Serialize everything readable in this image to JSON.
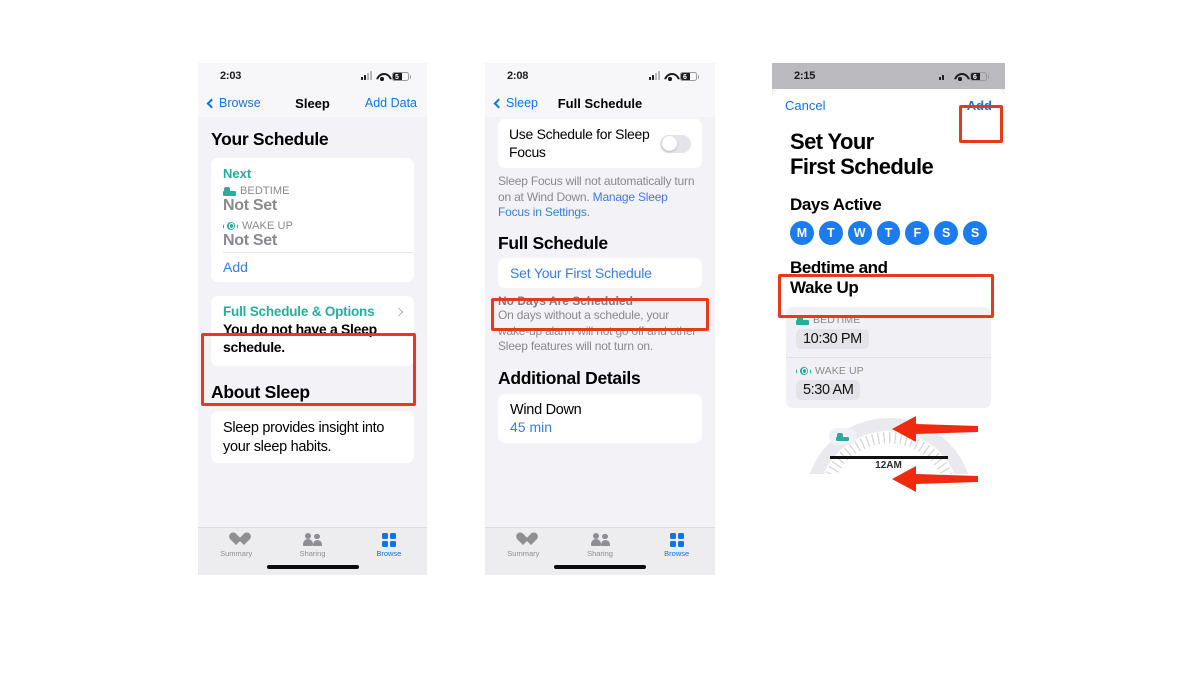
{
  "colors": {
    "annotation_red": "#e8391b",
    "ios_blue": "#1673d8",
    "link_blue": "#3b7ddd",
    "teal": "#2bab9e",
    "day_blue": "#1a7ced",
    "gray_text": "#8a8a8e"
  },
  "screen1": {
    "status": {
      "time": "2:03",
      "signal_icon": "cellular-signal-icon",
      "wifi_icon": "wifi-icon",
      "battery_icon": "battery-low-icon"
    },
    "nav": {
      "back_label": "Browse",
      "title": "Sleep",
      "right_label": "Add Data"
    },
    "section_title": "Your Schedule",
    "schedule_card": {
      "next_label": "Next",
      "bedtime_label": "BEDTIME",
      "bedtime_value": "Not Set",
      "wakeup_label": "WAKE UP",
      "wakeup_value": "Not Set",
      "add_label": "Add"
    },
    "full_schedule": {
      "link_label": "Full Schedule & Options",
      "message": "You do not have a Sleep schedule."
    },
    "about_title": "About Sleep",
    "about_body": "Sleep provides insight into your sleep habits.",
    "tabs": [
      {
        "label": "Summary",
        "icon": "heart-icon",
        "active": false
      },
      {
        "label": "Sharing",
        "icon": "people-icon",
        "active": false
      },
      {
        "label": "Browse",
        "icon": "grid-icon",
        "active": true
      }
    ]
  },
  "screen2": {
    "status": {
      "time": "2:08"
    },
    "nav": {
      "back_label": "Sleep",
      "title": "Full Schedule"
    },
    "focus_row": {
      "label": "Use Schedule for Sleep Focus",
      "toggle_state": "off"
    },
    "focus_helper_text": "Sleep Focus will not automatically turn on at Wind Down. ",
    "focus_helper_link": "Manage Sleep Focus in Settings.",
    "full_schedule_title": "Full Schedule",
    "set_first_schedule_label": "Set Your First Schedule",
    "no_days_title": "No Days Are Scheduled",
    "no_days_body": "On days without a schedule, your wake-up alarm will not go off and other Sleep features will not turn on.",
    "additional_details_title": "Additional Details",
    "wind_down": {
      "label": "Wind Down",
      "value": "45 min"
    },
    "tabs": [
      {
        "label": "Summary",
        "icon": "heart-icon",
        "active": false
      },
      {
        "label": "Sharing",
        "icon": "people-icon",
        "active": false
      },
      {
        "label": "Browse",
        "icon": "grid-icon",
        "active": true
      }
    ]
  },
  "screen3": {
    "status": {
      "time": "2:15"
    },
    "sheet_nav": {
      "cancel_label": "Cancel",
      "add_label": "Add"
    },
    "title_line1": "Set Your",
    "title_line2": "First Schedule",
    "days_active_title": "Days Active",
    "days": [
      {
        "letter": "M",
        "active": true
      },
      {
        "letter": "T",
        "active": true
      },
      {
        "letter": "W",
        "active": true
      },
      {
        "letter": "T",
        "active": true
      },
      {
        "letter": "F",
        "active": true
      },
      {
        "letter": "S",
        "active": true
      },
      {
        "letter": "S",
        "active": true
      }
    ],
    "bedtime_wakeup_title_line1": "Bedtime and",
    "bedtime_wakeup_title_line2": "Wake Up",
    "bedtime": {
      "label": "BEDTIME",
      "value": "10:30 PM",
      "icon": "bed-icon"
    },
    "wakeup": {
      "label": "WAKE UP",
      "value": "5:30 AM",
      "icon": "alarm-icon"
    },
    "dial_label": "12AM"
  }
}
